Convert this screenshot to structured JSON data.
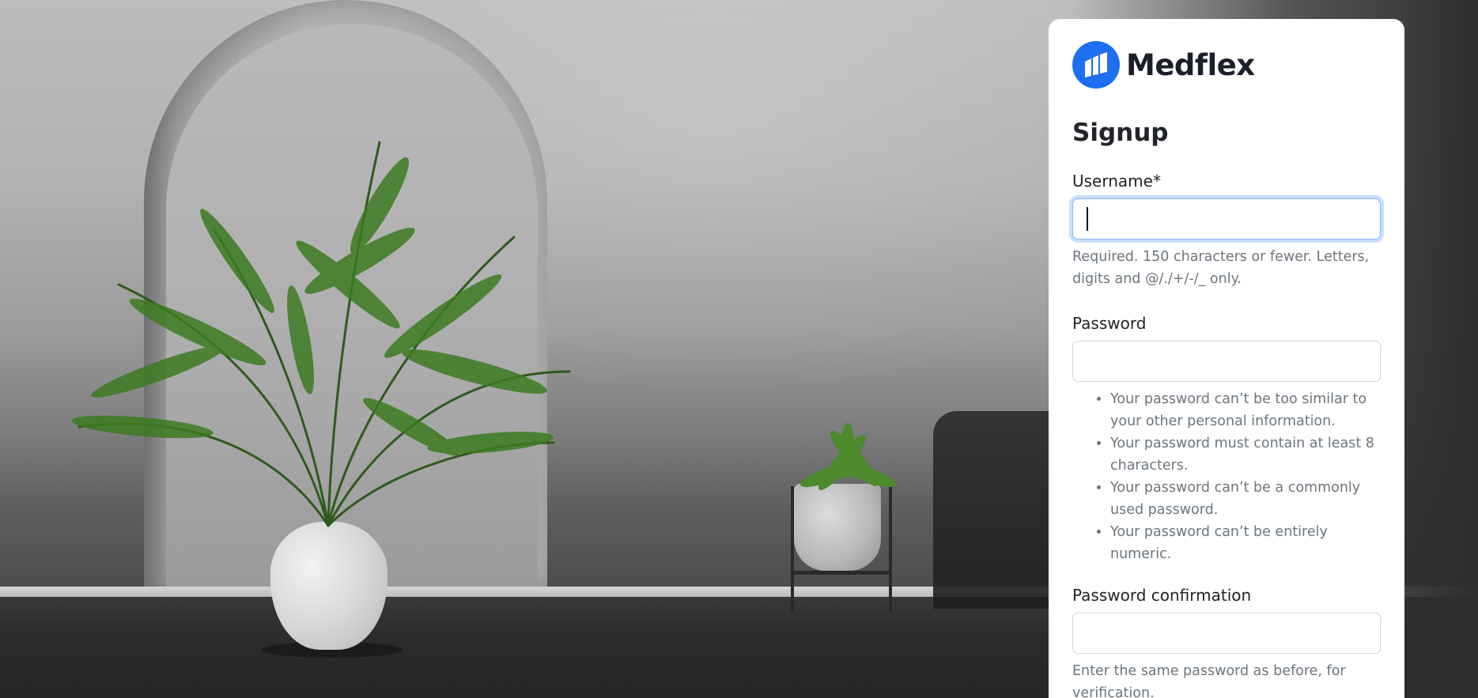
{
  "brand": {
    "name": "Medflex",
    "logo_icon": "medflex-logo-icon",
    "logo_color": "#1d6ef0"
  },
  "form": {
    "title": "Signup",
    "username": {
      "label": "Username*",
      "value": "",
      "placeholder": "",
      "help": "Required. 150 characters or fewer. Letters, digits and @/./+/-/_ only."
    },
    "password": {
      "label": "Password",
      "value": "",
      "placeholder": "",
      "rules": [
        "Your password can’t be too similar to your other personal information.",
        "Your password must contain at least 8 characters.",
        "Your password can’t be a commonly used password.",
        "Your password can’t be entirely numeric."
      ]
    },
    "password_confirmation": {
      "label": "Password confirmation",
      "value": "",
      "placeholder": "",
      "help": "Enter the same password as before, for verification."
    }
  },
  "colors": {
    "focus_border": "#86b7fe",
    "help_text": "#6c757d",
    "card_background": "#ffffff"
  }
}
